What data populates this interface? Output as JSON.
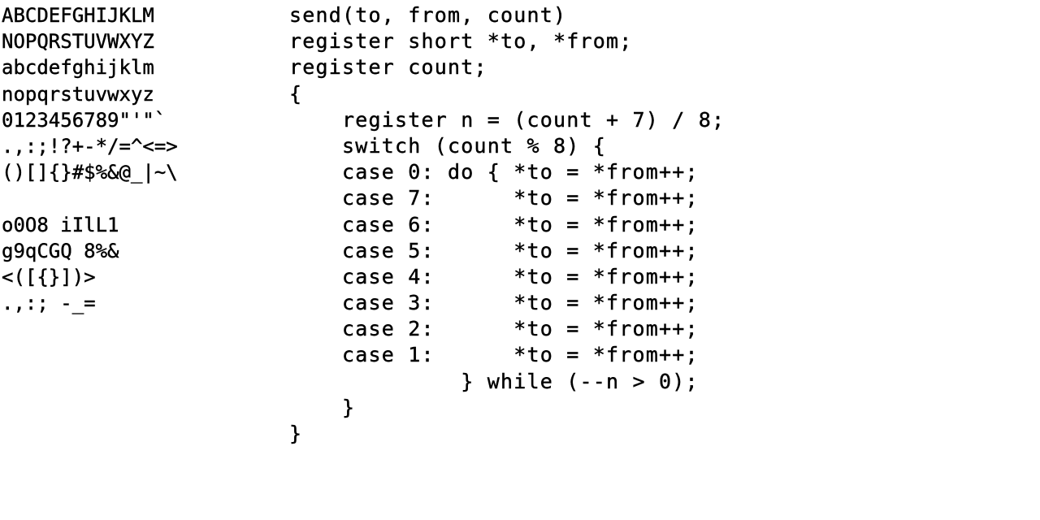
{
  "charset_lines": [
    "ABCDEFGHIJKLM",
    "NOPQRSTUVWXYZ",
    "abcdefghijklm",
    "nopqrstuvwxyz",
    "0123456789\"'\"`",
    ".,:;!?+-*/=^<=>",
    "()[]{}#$%&@_|~\\",
    "",
    "o0O8 iIlL1",
    "g9qCGQ 8%&",
    "<([{}])>",
    ".,:; -_="
  ],
  "code_lines": [
    "send(to, from, count)",
    "register short *to, *from;",
    "register count;",
    "{",
    "    register n = (count + 7) / 8;",
    "    switch (count % 8) {",
    "    case 0: do { *to = *from++;",
    "    case 7:      *to = *from++;",
    "    case 6:      *to = *from++;",
    "    case 5:      *to = *from++;",
    "    case 4:      *to = *from++;",
    "    case 3:      *to = *from++;",
    "    case 2:      *to = *from++;",
    "    case 1:      *to = *from++;",
    "             } while (--n > 0);",
    "    }",
    "}"
  ]
}
